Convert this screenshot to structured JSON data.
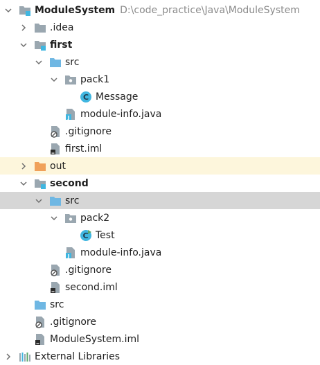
{
  "colors": {
    "folder_blue": "#6fb7e3",
    "folder_grey": "#9aa7b0",
    "folder_orange": "#f0a15a",
    "class_cyan": "#40b6e0",
    "selected_row": "#d6d6d6",
    "excluded_row": "#fdf6dc",
    "path_grey": "#8a8a8a"
  },
  "tree": [
    {
      "label": "ModuleSystem",
      "path": "D:\\code_practice\\Java\\ModuleSystem",
      "icon": "module-folder-icon",
      "expanded": true
    },
    {
      "label": ".idea",
      "icon": "folder-icon",
      "expanded": false
    },
    {
      "label": "first",
      "icon": "module-folder-icon",
      "expanded": true
    },
    {
      "label": "src",
      "icon": "source-folder-icon",
      "expanded": true
    },
    {
      "label": "pack1",
      "icon": "package-icon",
      "expanded": true
    },
    {
      "label": "Message",
      "icon": "class-icon"
    },
    {
      "label": "module-info.java",
      "icon": "java-file-icon"
    },
    {
      "label": ".gitignore",
      "icon": "ignored-file-icon"
    },
    {
      "label": "first.iml",
      "icon": "iml-file-icon"
    },
    {
      "label": "out",
      "icon": "excluded-folder-icon",
      "expanded": false
    },
    {
      "label": "second",
      "icon": "module-folder-icon",
      "expanded": true
    },
    {
      "label": "src",
      "icon": "source-folder-icon",
      "expanded": true,
      "selected": true
    },
    {
      "label": "pack2",
      "icon": "package-icon",
      "expanded": true
    },
    {
      "label": "Test",
      "icon": "runnable-class-icon"
    },
    {
      "label": "module-info.java",
      "icon": "java-file-icon"
    },
    {
      "label": ".gitignore",
      "icon": "ignored-file-icon"
    },
    {
      "label": "second.iml",
      "icon": "iml-file-icon"
    },
    {
      "label": "src",
      "icon": "source-folder-icon"
    },
    {
      "label": ".gitignore",
      "icon": "ignored-file-icon"
    },
    {
      "label": "ModuleSystem.iml",
      "icon": "iml-file-icon"
    },
    {
      "label": "External Libraries",
      "icon": "libraries-icon",
      "expanded": false
    }
  ]
}
